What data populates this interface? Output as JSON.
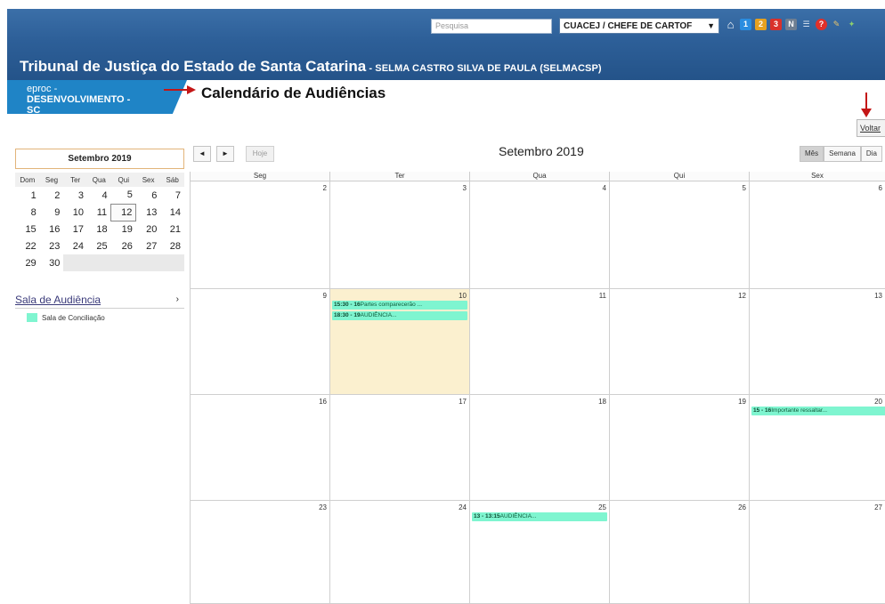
{
  "header": {
    "search_placeholder": "Pesquisa",
    "role": "CUACEJ / CHEFE DE CARTOF",
    "court_title": "Tribunal de Justiça do Estado de Santa Catarina",
    "user": " - SELMA CASTRO SILVA DE PAULA (SELMACSP)",
    "icons": [
      "home-icon",
      "badge-1-icon",
      "badge-2-icon",
      "badge-3-icon",
      "n-icon",
      "list-icon",
      "help-icon",
      "wrench-icon",
      "tool-icon"
    ]
  },
  "env_tab": {
    "line1": "eproc -",
    "line2": "DESENVOLVIMENTO -",
    "line3": "SC"
  },
  "page_title": "Calendário de Audiências",
  "voltar_label": "Voltar",
  "mini_calendar": {
    "title": "Setembro 2019",
    "weekdays": [
      "Dom",
      "Seg",
      "Ter",
      "Qua",
      "Qui",
      "Sex",
      "Sáb"
    ],
    "weeks": [
      [
        "1",
        "2",
        "3",
        "4",
        "5",
        "6",
        "7"
      ],
      [
        "8",
        "9",
        "10",
        "11",
        "12",
        "13",
        "14"
      ],
      [
        "15",
        "16",
        "17",
        "18",
        "19",
        "20",
        "21"
      ],
      [
        "22",
        "23",
        "24",
        "25",
        "26",
        "27",
        "28"
      ],
      [
        "29",
        "30",
        "",
        "",
        "",
        "",
        ""
      ]
    ],
    "today": "12"
  },
  "sala": {
    "title": "Sala de Audiência",
    "chevron": "›",
    "item": "Sala de Conciliação",
    "color": "#7ff5d0"
  },
  "calendar": {
    "prev": "◄",
    "next": "►",
    "today_label": "Hoje",
    "title": "Setembro 2019",
    "views": [
      "Mês",
      "Semana",
      "Dia"
    ],
    "weekdays": [
      "Seg",
      "Ter",
      "Qua",
      "Qui",
      "Sex"
    ],
    "rows": [
      [
        "2",
        "3",
        "4",
        "5",
        "6"
      ],
      [
        "9",
        "10",
        "11",
        "12",
        "13"
      ],
      [
        "16",
        "17",
        "18",
        "19",
        "20"
      ],
      [
        "23",
        "24",
        "25",
        "26",
        "27"
      ]
    ],
    "events": {
      "e1": {
        "time": "15:30 - 16",
        "text": "Partes comparecerão ..."
      },
      "e2": {
        "time": "18:30 - 19",
        "text": "AUDIÊNCIA..."
      },
      "e3": {
        "time": "15 - 16",
        "text": "Importante ressaltar..."
      },
      "e4": {
        "time": "13 - 13:15",
        "text": "AUDIÊNCIA..."
      }
    }
  }
}
